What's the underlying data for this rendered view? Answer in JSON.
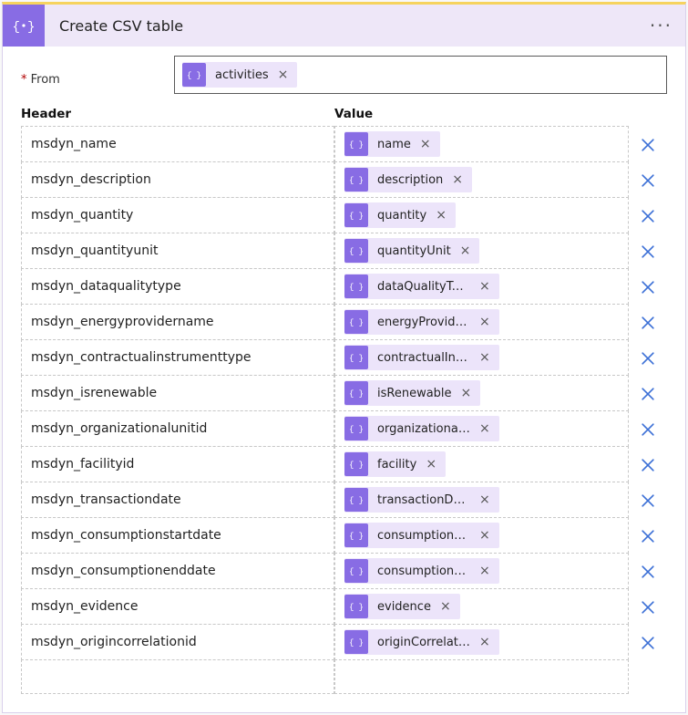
{
  "title": "Create CSV table",
  "from": {
    "label": "From",
    "token": "activities"
  },
  "columns": {
    "header": "Header",
    "value": "Value"
  },
  "rows": [
    {
      "header": "msdyn_name",
      "value": "name"
    },
    {
      "header": "msdyn_description",
      "value": "description"
    },
    {
      "header": "msdyn_quantity",
      "value": "quantity"
    },
    {
      "header": "msdyn_quantityunit",
      "value": "quantityUnit"
    },
    {
      "header": "msdyn_dataqualitytype",
      "value": "dataQualityType"
    },
    {
      "header": "msdyn_energyprovidername",
      "value": "energyProvider..."
    },
    {
      "header": "msdyn_contractualinstrumenttype",
      "value": "contractualInst..."
    },
    {
      "header": "msdyn_isrenewable",
      "value": "isRenewable"
    },
    {
      "header": "msdyn_organizationalunitid",
      "value": "organizational..."
    },
    {
      "header": "msdyn_facilityid",
      "value": "facility"
    },
    {
      "header": "msdyn_transactiondate",
      "value": "transactionDate"
    },
    {
      "header": "msdyn_consumptionstartdate",
      "value": "consumptionSt..."
    },
    {
      "header": "msdyn_consumptionenddate",
      "value": "consumptionE..."
    },
    {
      "header": "msdyn_evidence",
      "value": "evidence"
    },
    {
      "header": "msdyn_origincorrelationid",
      "value": "originCorrelati..."
    }
  ]
}
